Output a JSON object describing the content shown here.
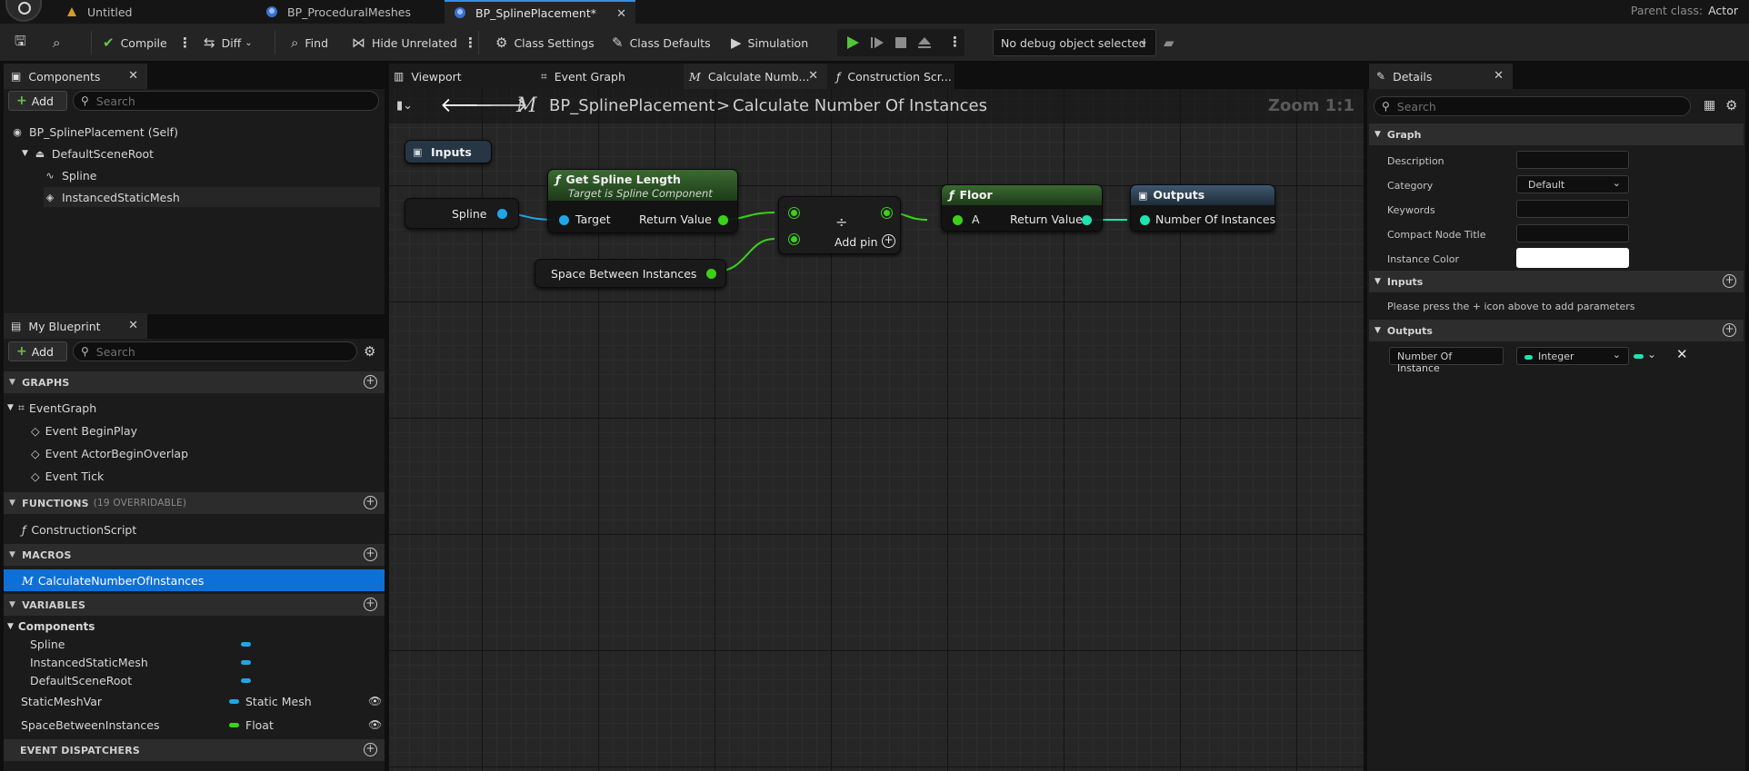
{
  "document_tabs": [
    {
      "label": "Untitled",
      "active": false
    },
    {
      "label": "BP_ProceduralMeshes",
      "active": false
    },
    {
      "label": "BP_SplinePlacement*",
      "active": true
    }
  ],
  "parent_class": {
    "label": "Parent class:",
    "value": "Actor"
  },
  "toolbar": {
    "compile": "Compile",
    "diff": "Diff",
    "find": "Find",
    "hide_unrelated": "Hide Unrelated",
    "class_settings": "Class Settings",
    "class_defaults": "Class Defaults",
    "simulation": "Simulation",
    "debug_object": "No debug object selected"
  },
  "components_panel": {
    "title": "Components",
    "add_label": "Add",
    "search_placeholder": "Search",
    "tree": [
      {
        "label": "BP_SplinePlacement (Self)",
        "icon": "blueprint-icon"
      },
      {
        "label": "DefaultSceneRoot",
        "icon": "scene-root-icon"
      },
      {
        "label": "Spline",
        "icon": "spline-icon"
      },
      {
        "label": "InstancedStaticMesh",
        "icon": "mesh-icon"
      }
    ]
  },
  "my_blueprint": {
    "title": "My Blueprint",
    "add_label": "Add",
    "search_placeholder": "Search",
    "graphs_header": "GRAPHS",
    "event_graph": "EventGraph",
    "events": [
      "Event BeginPlay",
      "Event ActorBeginOverlap",
      "Event Tick"
    ],
    "functions_header": "FUNCTIONS",
    "functions_sub": "(19 OVERRIDABLE)",
    "functions": [
      "ConstructionScript"
    ],
    "macros_header": "MACROS",
    "macros": [
      "CalculateNumberOfInstances"
    ],
    "variables_header": "VARIABLES",
    "components_group": "Components",
    "component_vars": [
      "Spline",
      "InstancedStaticMesh",
      "DefaultSceneRoot"
    ],
    "variables": [
      {
        "name": "StaticMeshVar",
        "type": "Static Mesh",
        "color": "#1ea7e8"
      },
      {
        "name": "SpaceBetweenInstances",
        "type": "Float",
        "color": "#3bd11b"
      }
    ],
    "dispatchers_header": "EVENT DISPATCHERS"
  },
  "editor_tabs": [
    {
      "label": "Viewport",
      "icon": "viewport-icon"
    },
    {
      "label": "Event Graph",
      "icon": "event-graph-icon"
    },
    {
      "label": "Calculate Numb...",
      "icon": "macro-icon",
      "active": true
    },
    {
      "label": "Construction Scr...",
      "icon": "function-icon"
    }
  ],
  "graph": {
    "breadcrumb_root": "BP_SplinePlacement",
    "breadcrumb_sep": ">",
    "breadcrumb_leaf": "Calculate Number Of Instances",
    "zoom": "Zoom 1:1",
    "nodes": {
      "inputs": "Inputs",
      "spline_pin": "Spline",
      "get_spline_length": "Get Spline Length",
      "get_spline_sub": "Target is Spline Component",
      "target": "Target",
      "return_value": "Return Value",
      "space_between": "Space Between Instances",
      "divide_symbol": "÷",
      "add_pin": "Add pin",
      "floor": "Floor",
      "floor_a": "A",
      "floor_return": "Return Value",
      "outputs": "Outputs",
      "output_pin": "Number Of Instances"
    }
  },
  "details": {
    "title": "Details",
    "search_placeholder": "Search",
    "graph_section": "Graph",
    "rows": [
      "Description",
      "Category",
      "Keywords",
      "Compact Node Title",
      "Instance Color"
    ],
    "category_value": "Default",
    "inputs_section": "Inputs",
    "inputs_hint": "Please press the + icon above to add parameters",
    "outputs_section": "Outputs",
    "output_name": "Number Of Instance",
    "output_type": "Integer"
  },
  "colors": {
    "accent_blue": "#0d70d9",
    "object_pin": "#1ea7e8",
    "float_pin": "#3bd11b",
    "int_pin": "#1fe3b0",
    "exec_white": "#ffffff"
  }
}
